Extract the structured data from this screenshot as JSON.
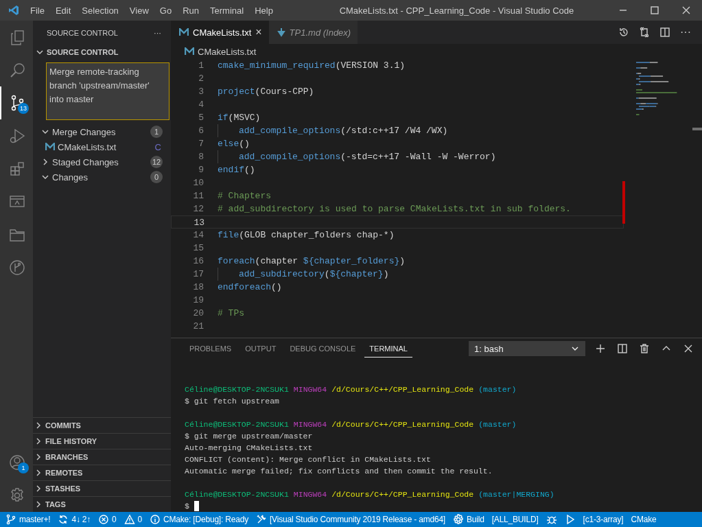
{
  "window": {
    "title": "CMakeLists.txt - CPP_Learning_Code - Visual Studio Code"
  },
  "menu": [
    "File",
    "Edit",
    "Selection",
    "View",
    "Go",
    "Run",
    "Terminal",
    "Help"
  ],
  "activity_bar": [
    {
      "kind": "explorer",
      "selected": false
    },
    {
      "kind": "search",
      "selected": false
    },
    {
      "kind": "scm",
      "selected": true,
      "badge": "13"
    },
    {
      "kind": "debug",
      "selected": false
    },
    {
      "kind": "extensions",
      "selected": false
    },
    {
      "kind": "remote",
      "selected": false
    },
    {
      "kind": "folder",
      "selected": false
    },
    {
      "kind": "graph",
      "selected": false
    }
  ],
  "activity_bottom": [
    {
      "kind": "account",
      "badge": "1"
    },
    {
      "kind": "settings"
    }
  ],
  "sidebar": {
    "title": "SOURCE CONTROL",
    "more": "···",
    "section": {
      "title": "SOURCE CONTROL",
      "expanded": true
    },
    "commit_message": "Merge remote-tracking branch 'upstream/master' into master",
    "groups": [
      {
        "label": "Merge Changes",
        "expanded": true,
        "count": "1",
        "files": [
          {
            "name": "CMakeLists.txt",
            "status": "C"
          }
        ]
      },
      {
        "label": "Staged Changes",
        "expanded": false,
        "count": "12"
      },
      {
        "label": "Changes",
        "expanded": true,
        "count": "0"
      }
    ],
    "bottom_sections": [
      {
        "label": "COMMITS",
        "expanded": false
      },
      {
        "label": "FILE HISTORY",
        "expanded": false
      },
      {
        "label": "BRANCHES",
        "expanded": false
      },
      {
        "label": "REMOTES",
        "expanded": false
      },
      {
        "label": "STASHES",
        "expanded": false
      },
      {
        "label": "TAGS",
        "expanded": false
      }
    ]
  },
  "tabs": [
    {
      "label": "CMakeLists.txt",
      "kind": "cmake",
      "selected": true,
      "close": "×"
    },
    {
      "label": "TP1.md (Index)",
      "kind": "markdown",
      "selected": false
    }
  ],
  "editor_actions_more": "···",
  "breadcrumb": "CMakeLists.txt",
  "code": [
    {
      "number": "1",
      "current": false,
      "indented": false,
      "tokens": [
        {
          "kind": "fn",
          "text": "cmake_minimum_required"
        },
        {
          "kind": "plain",
          "text": "(VERSION 3.1)"
        }
      ]
    },
    {
      "number": "2",
      "current": false,
      "indented": false
    },
    {
      "number": "3",
      "current": false,
      "indented": false,
      "tokens": [
        {
          "kind": "fn",
          "text": "project"
        },
        {
          "kind": "plain",
          "text": "(Cours-CPP)"
        }
      ]
    },
    {
      "number": "4",
      "current": false,
      "indented": false
    },
    {
      "number": "5",
      "current": false,
      "indented": false,
      "tokens": [
        {
          "kind": "fn",
          "text": "if"
        },
        {
          "kind": "plain",
          "text": "(MSVC)"
        }
      ]
    },
    {
      "number": "6",
      "current": false,
      "indented": true,
      "tokens": [
        {
          "kind": "fn",
          "text": "add_compile_options"
        },
        {
          "kind": "plain",
          "text": "(/std:c++17 /W4 /WX)"
        }
      ]
    },
    {
      "number": "7",
      "current": false,
      "indented": false,
      "tokens": [
        {
          "kind": "fn",
          "text": "else"
        },
        {
          "kind": "plain",
          "text": "()"
        }
      ]
    },
    {
      "number": "8",
      "current": false,
      "indented": true,
      "tokens": [
        {
          "kind": "fn",
          "text": "add_compile_options"
        },
        {
          "kind": "plain",
          "text": "(-std=c++17 -Wall -W -Werror)"
        }
      ]
    },
    {
      "number": "9",
      "current": false,
      "indented": false,
      "tokens": [
        {
          "kind": "fn",
          "text": "endif"
        },
        {
          "kind": "plain",
          "text": "()"
        }
      ]
    },
    {
      "number": "10",
      "current": false,
      "indented": false
    },
    {
      "number": "11",
      "current": false,
      "indented": false,
      "tokens": [
        {
          "kind": "comment",
          "text": "# Chapters"
        }
      ]
    },
    {
      "number": "12",
      "current": false,
      "indented": false,
      "tokens": [
        {
          "kind": "comment",
          "text": "# add_subdirectory is used to parse CMakeLists.txt in sub folders."
        }
      ]
    },
    {
      "number": "13",
      "current": true,
      "indented": false
    },
    {
      "number": "14",
      "current": false,
      "indented": false,
      "tokens": [
        {
          "kind": "fn",
          "text": "file"
        },
        {
          "kind": "plain",
          "text": "(GLOB chapter_folders chap-*)"
        }
      ]
    },
    {
      "number": "15",
      "current": false,
      "indented": false
    },
    {
      "number": "16",
      "current": false,
      "indented": false,
      "tokens": [
        {
          "kind": "fn",
          "text": "foreach"
        },
        {
          "kind": "plain",
          "text": "(chapter "
        },
        {
          "kind": "var",
          "text": "${chapter_folders}"
        },
        {
          "kind": "plain",
          "text": ")"
        }
      ]
    },
    {
      "number": "17",
      "current": false,
      "indented": true,
      "tokens": [
        {
          "kind": "fn",
          "text": "add_subdirectory"
        },
        {
          "kind": "plain",
          "text": "("
        },
        {
          "kind": "var",
          "text": "${chapter}"
        },
        {
          "kind": "plain",
          "text": ")"
        }
      ]
    },
    {
      "number": "18",
      "current": false,
      "indented": false,
      "tokens": [
        {
          "kind": "fn",
          "text": "endforeach"
        },
        {
          "kind": "plain",
          "text": "()"
        }
      ]
    },
    {
      "number": "19",
      "current": false,
      "indented": false
    },
    {
      "number": "20",
      "current": false,
      "indented": false,
      "tokens": [
        {
          "kind": "comment",
          "text": "# TPs"
        }
      ]
    },
    {
      "number": "21",
      "current": false,
      "indented": false
    }
  ],
  "panel": {
    "tabs": [
      {
        "label": "PROBLEMS",
        "selected": false
      },
      {
        "label": "OUTPUT",
        "selected": false
      },
      {
        "label": "DEBUG CONSOLE",
        "selected": false
      },
      {
        "label": "TERMINAL",
        "selected": true
      }
    ],
    "terminal_select": "1: bash",
    "terminal": [
      [
        {
          "kind": "user",
          "text": "Céline@DESKTOP-2NCSUK1"
        },
        {
          "kind": "host",
          "text": "MINGW64"
        },
        {
          "kind": "path",
          "text": "/d/Cours/C++/CPP_Learning_Code"
        },
        {
          "kind": "branch",
          "text": "(master)"
        }
      ],
      [
        {
          "kind": "out",
          "text": "$ git fetch upstream"
        }
      ],
      [
        {
          "kind": "user",
          "text": "Céline@DESKTOP-2NCSUK1"
        },
        {
          "kind": "host",
          "text": "MINGW64"
        },
        {
          "kind": "path",
          "text": "/d/Cours/C++/CPP_Learning_Code"
        },
        {
          "kind": "branch",
          "text": "(master)"
        }
      ],
      [
        {
          "kind": "out",
          "text": "$ git merge upstream/master"
        }
      ],
      [
        {
          "kind": "out",
          "text": "Auto-merging CMakeLists.txt"
        }
      ],
      [
        {
          "kind": "out",
          "text": "CONFLICT (content): Merge conflict in CMakeLists.txt"
        }
      ],
      [
        {
          "kind": "out",
          "text": "Automatic merge failed; fix conflicts and then commit the result."
        }
      ],
      [
        {
          "kind": "user",
          "text": "Céline@DESKTOP-2NCSUK1"
        },
        {
          "kind": "host",
          "text": "MINGW64"
        },
        {
          "kind": "path",
          "text": "/d/Cours/C++/CPP_Learning_Code"
        },
        {
          "kind": "branch",
          "text": "(master|MERGING)"
        }
      ],
      [
        {
          "kind": "out",
          "text": "$"
        },
        {
          "kind": "cursor"
        }
      ]
    ]
  },
  "status_bar": [
    {
      "kind": "branch",
      "text": "master+!"
    },
    {
      "kind": "sync",
      "text": "4↓ 2↑"
    },
    {
      "kind": "errors",
      "text": "0"
    },
    {
      "kind": "warnings",
      "text": "0"
    },
    {
      "kind": "info",
      "text": "CMake: [Debug]: Ready"
    },
    {
      "kind": "tools",
      "text": "[Visual Studio Community 2019 Release - amd64]"
    },
    {
      "kind": "gear",
      "text": "Build"
    },
    {
      "kind": "plain",
      "text": "[ALL_BUILD]"
    },
    {
      "kind": "bug"
    },
    {
      "kind": "play"
    },
    {
      "kind": "plain",
      "text": "[c1-3-array]"
    },
    {
      "kind": "plain",
      "text": "CMake"
    }
  ]
}
